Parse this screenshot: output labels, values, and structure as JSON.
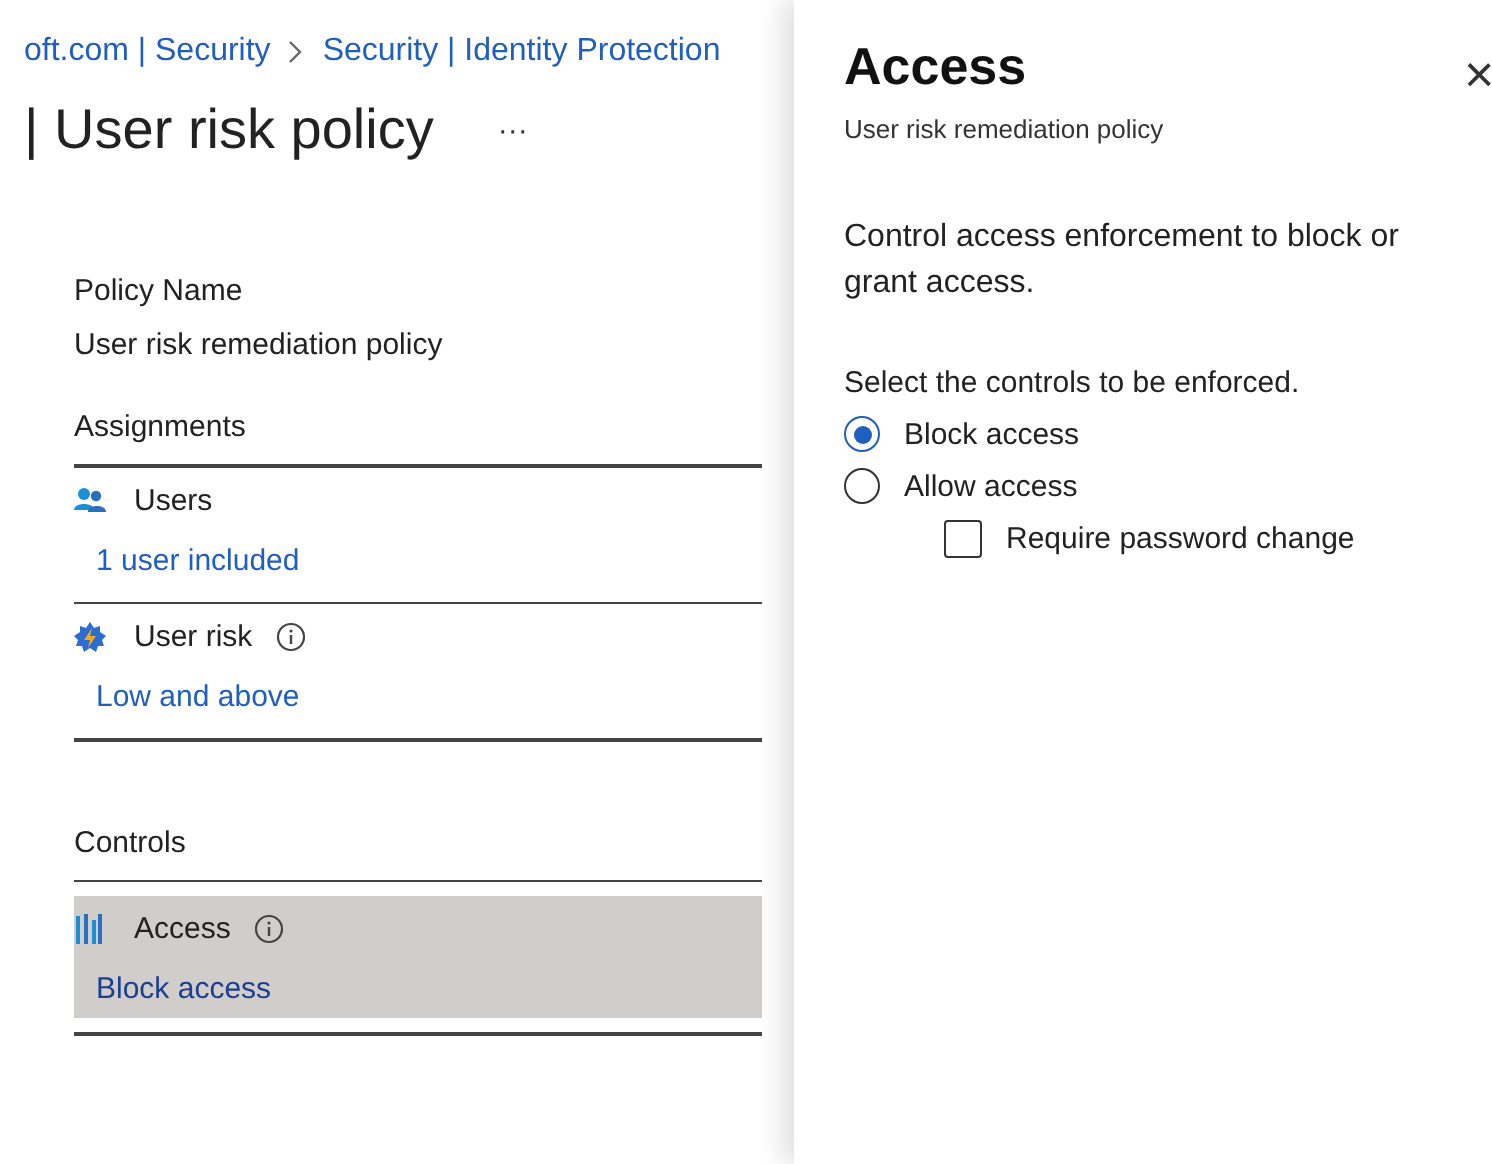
{
  "breadcrumb": [
    "oft.com | Security",
    "Security | Identity Protection"
  ],
  "page_title": "| User risk policy",
  "more": "···",
  "policy_name": {
    "label": "Policy Name",
    "value": "User risk remediation policy"
  },
  "assignments": {
    "heading": "Assignments",
    "items": [
      {
        "kind": "users",
        "label": "Users",
        "info": false,
        "value": "1 user included",
        "selected": false
      },
      {
        "kind": "risk",
        "label": "User risk",
        "info": true,
        "value": "Low and above",
        "selected": false
      }
    ]
  },
  "controls": {
    "heading": "Controls",
    "items": [
      {
        "kind": "access",
        "label": "Access",
        "info": true,
        "value": "Block access",
        "selected": true
      }
    ]
  },
  "panel": {
    "title": "Access",
    "subtitle": "User risk remediation policy",
    "close": "×",
    "description": "Control access enforcement to block or grant access.",
    "prompt": "Select the controls to be enforced.",
    "options": [
      {
        "label": "Block access",
        "selected": true
      },
      {
        "label": "Allow access",
        "selected": false
      }
    ],
    "checkbox": {
      "label": "Require password change",
      "checked": false
    }
  }
}
